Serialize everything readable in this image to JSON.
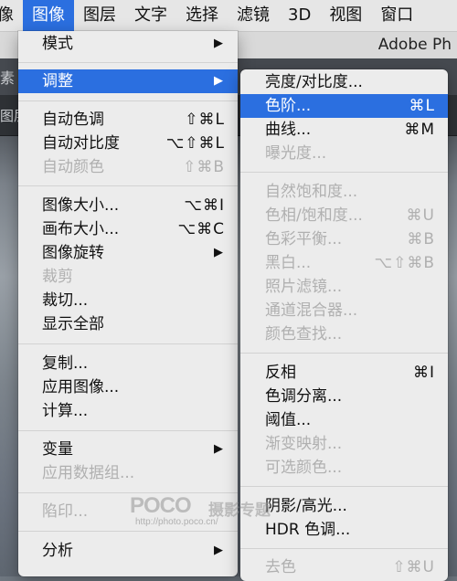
{
  "menubar": {
    "items": [
      "像",
      "图像",
      "图层",
      "文字",
      "选择",
      "滤镜",
      "3D",
      "视图",
      "窗口"
    ],
    "active_index": 1
  },
  "background": {
    "window_title": "Adobe Ph",
    "options_text": "素",
    "tab_text": "图层"
  },
  "image_menu": {
    "items": [
      {
        "label": "模式",
        "submenu": true
      },
      {
        "label": "调整",
        "submenu": true,
        "highlighted": true
      },
      {
        "label": "自动色调",
        "shortcut": "⇧⌘L"
      },
      {
        "label": "自动对比度",
        "shortcut": "⌥⇧⌘L"
      },
      {
        "label": "自动颜色",
        "shortcut": "⇧⌘B",
        "disabled": true
      },
      {
        "label": "图像大小...",
        "shortcut": "⌥⌘I"
      },
      {
        "label": "画布大小...",
        "shortcut": "⌥⌘C"
      },
      {
        "label": "图像旋转",
        "submenu": true
      },
      {
        "label": "裁剪",
        "disabled": true
      },
      {
        "label": "裁切..."
      },
      {
        "label": "显示全部"
      },
      {
        "label": "复制..."
      },
      {
        "label": "应用图像..."
      },
      {
        "label": "计算..."
      },
      {
        "label": "变量",
        "submenu": true
      },
      {
        "label": "应用数据组...",
        "disabled": true
      },
      {
        "label": "陷印...",
        "disabled": true
      },
      {
        "label": "分析",
        "submenu": true
      }
    ]
  },
  "adjustments_submenu": {
    "items": [
      {
        "label": "亮度/对比度..."
      },
      {
        "label": "色阶...",
        "shortcut": "⌘L",
        "highlighted": true
      },
      {
        "label": "曲线...",
        "shortcut": "⌘M"
      },
      {
        "label": "曝光度...",
        "disabled": true
      },
      {
        "label": "自然饱和度...",
        "disabled": true
      },
      {
        "label": "色相/饱和度...",
        "shortcut": "⌘U",
        "disabled": true
      },
      {
        "label": "色彩平衡...",
        "shortcut": "⌘B",
        "disabled": true
      },
      {
        "label": "黑白...",
        "shortcut": "⌥⇧⌘B",
        "disabled": true
      },
      {
        "label": "照片滤镜...",
        "disabled": true
      },
      {
        "label": "通道混合器...",
        "disabled": true
      },
      {
        "label": "颜色查找...",
        "disabled": true
      },
      {
        "label": "反相",
        "shortcut": "⌘I"
      },
      {
        "label": "色调分离..."
      },
      {
        "label": "阈值..."
      },
      {
        "label": "渐变映射...",
        "disabled": true
      },
      {
        "label": "可选颜色...",
        "disabled": true
      },
      {
        "label": "阴影/高光..."
      },
      {
        "label": "HDR 色调..."
      },
      {
        "label": "去色",
        "shortcut": "⇧⌘U",
        "disabled": true
      }
    ]
  },
  "watermark": {
    "brand": "POCO",
    "brand_cn": "摄影专题",
    "url": "http://photo.poco.cn/"
  },
  "colors": {
    "highlight": "#2b6fe0",
    "menu_bg": "#ececec",
    "disabled_text": "#b0b0b0"
  }
}
